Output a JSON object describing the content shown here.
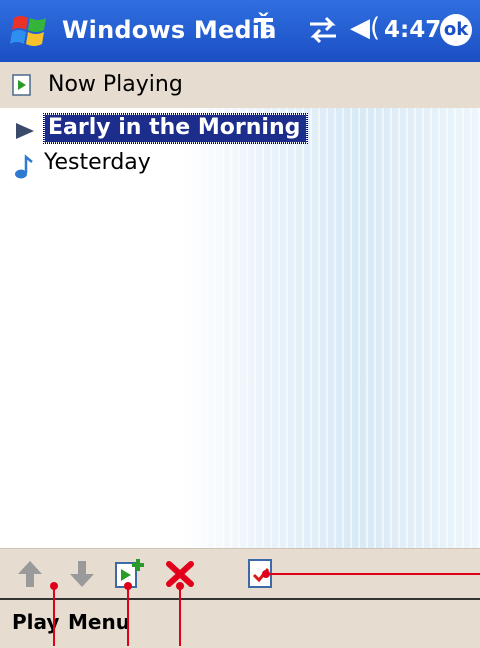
{
  "titlebar": {
    "title": "Windows Media",
    "clock": "4:47",
    "ok_label": "ok",
    "icons": [
      "windows-start-icon",
      "signal-antenna-icon",
      "connectivity-icon",
      "volume-icon"
    ],
    "color": "#1b4fc4"
  },
  "subheader": {
    "label": "Now Playing",
    "icon": "now-playing-icon"
  },
  "playlist": {
    "items": [
      {
        "label": "Early in the Morning",
        "selected": true,
        "icon": "play-arrow-icon"
      },
      {
        "label": "Yesterday",
        "selected": false,
        "icon": "music-note-icon"
      }
    ],
    "selection_color": "#1c2d8c"
  },
  "toolbar": {
    "buttons": [
      "move-up-icon",
      "move-down-icon",
      "add-to-playlist-icon",
      "remove-icon",
      "properties-icon"
    ]
  },
  "menubar": {
    "left": "Play",
    "right": "Menu"
  },
  "callout_color": "#e0001a"
}
